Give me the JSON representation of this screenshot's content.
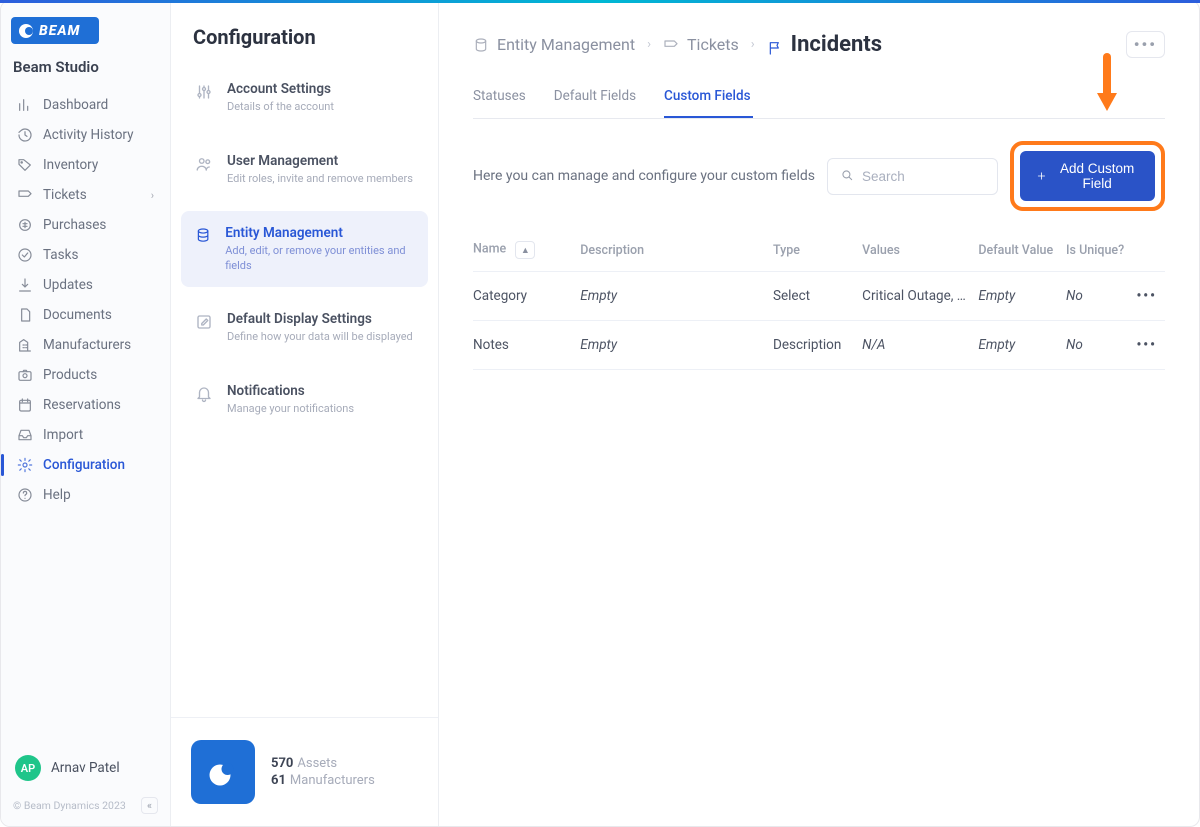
{
  "brand": {
    "logo_text": "BEAM",
    "org_name": "Beam Studio"
  },
  "sidebar": {
    "items": [
      {
        "label": "Dashboard",
        "icon": "bar-chart-icon"
      },
      {
        "label": "Activity History",
        "icon": "history-icon"
      },
      {
        "label": "Inventory",
        "icon": "tag-icon"
      },
      {
        "label": "Tickets",
        "icon": "ticket-icon",
        "has_children": true
      },
      {
        "label": "Purchases",
        "icon": "money-icon"
      },
      {
        "label": "Tasks",
        "icon": "check-circle-icon"
      },
      {
        "label": "Updates",
        "icon": "download-icon"
      },
      {
        "label": "Documents",
        "icon": "file-icon"
      },
      {
        "label": "Manufacturers",
        "icon": "building-icon"
      },
      {
        "label": "Products",
        "icon": "camera-icon"
      },
      {
        "label": "Reservations",
        "icon": "calendar-icon"
      },
      {
        "label": "Import",
        "icon": "inbox-icon"
      }
    ],
    "bottom": [
      {
        "label": "Configuration",
        "icon": "gear-icon",
        "active": true
      },
      {
        "label": "Help",
        "icon": "help-icon"
      }
    ],
    "user": {
      "initials": "AP",
      "name": "Arnav Patel"
    },
    "copyright": "© Beam Dynamics 2023",
    "collapse_glyph": "«"
  },
  "midcol": {
    "title": "Configuration",
    "items": [
      {
        "title": "Account Settings",
        "sub": "Details of the account"
      },
      {
        "title": "User Management",
        "sub": "Edit roles, invite and remove members"
      },
      {
        "title": "Entity Management",
        "sub": "Add, edit, or remove your entities and fields",
        "active": true
      },
      {
        "title": "Default Display Settings",
        "sub": "Define how your data will be displayed"
      },
      {
        "title": "Notifications",
        "sub": "Manage your notifications"
      }
    ],
    "stats": {
      "assets_count": "570",
      "assets_label": "Assets",
      "manu_count": "61",
      "manu_label": "Manufacturers"
    }
  },
  "main": {
    "breadcrumb": [
      {
        "label": "Entity Management"
      },
      {
        "label": "Tickets"
      },
      {
        "label": "Incidents",
        "active": true
      }
    ],
    "tabs": [
      {
        "label": "Statuses"
      },
      {
        "label": "Default Fields"
      },
      {
        "label": "Custom Fields",
        "active": true
      }
    ],
    "toolbar": {
      "intro": "Here you can manage and configure your custom fields",
      "search_placeholder": "Search",
      "add_label": "Add Custom Field"
    },
    "table": {
      "columns": [
        "Name",
        "Description",
        "Type",
        "Values",
        "Default Value",
        "Is Unique?"
      ],
      "rows": [
        {
          "name": "Category",
          "description": "Empty",
          "type": "Select",
          "values": "Critical Outage, …",
          "default": "Empty",
          "unique": "No"
        },
        {
          "name": "Notes",
          "description": "Empty",
          "type": "Description",
          "values": "N/A",
          "default": "Empty",
          "unique": "No"
        }
      ]
    }
  }
}
